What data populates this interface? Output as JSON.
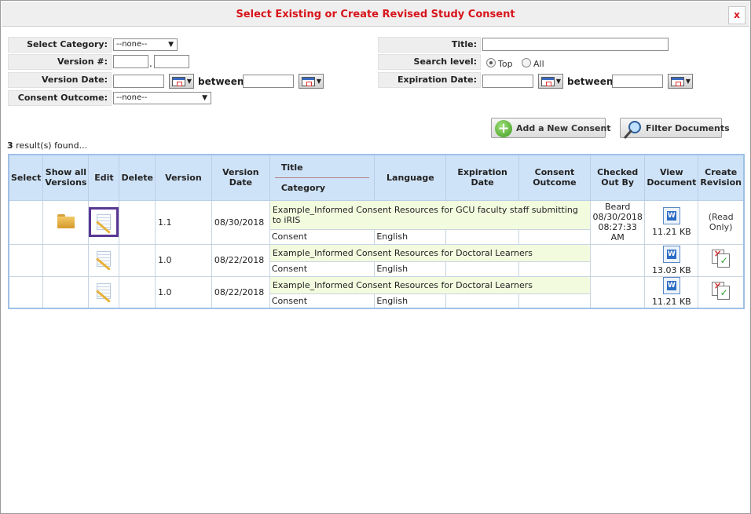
{
  "dialog": {
    "title": "Select Existing or Create Revised Study Consent",
    "close_label": "x"
  },
  "filters": {
    "category_label": "Select Category:",
    "category_value": "--none--",
    "version_label": "Version #:",
    "version_dot": ".",
    "version_date_label": "Version Date:",
    "between_label": "between",
    "outcome_label": "Consent Outcome:",
    "outcome_value": "--none--",
    "title_label": "Title:",
    "search_level_label": "Search level:",
    "search_level_options": [
      "Top",
      "All"
    ],
    "search_level_selected": "Top",
    "expiration_label": "Expiration Date:"
  },
  "actions": {
    "add_label": "Add a New Consent",
    "filter_label": "Filter Documents"
  },
  "results": {
    "count": "3",
    "suffix": " result(s) found..."
  },
  "table": {
    "headers": {
      "select": "Select",
      "show_all": "Show all Versions",
      "edit": "Edit",
      "delete": "Delete",
      "version": "Version",
      "version_date": "Version Date",
      "title": "Title",
      "category": "Category",
      "language": "Language",
      "expiration": "Expiration Date",
      "outcome": "Consent Outcome",
      "checked_out": "Checked Out By",
      "view": "View Document",
      "create_revision": "Create Revision"
    },
    "rows": [
      {
        "version": "1.1",
        "version_date": "08/30/2018",
        "title": "Example_Informed Consent Resources for GCU faculty staff submitting to iRIS",
        "category": "Consent",
        "language": "English",
        "expiration": "",
        "outcome": "",
        "checked_out": "Beard 08/30/2018 08:27:33 AM",
        "doc_size": "11.21 KB",
        "revision": "(Read Only)"
      },
      {
        "version": "1.0",
        "version_date": "08/22/2018",
        "title": "Example_Informed Consent Resources for Doctoral Learners",
        "category": "Consent",
        "language": "English",
        "expiration": "",
        "outcome": "",
        "checked_out": "",
        "doc_size": "13.03 KB",
        "revision": ""
      },
      {
        "version": "1.0",
        "version_date": "08/22/2018",
        "title": "Example_Informed Consent Resources for Doctoral Learners",
        "category": "Consent",
        "language": "English",
        "expiration": "",
        "outcome": "",
        "checked_out": "",
        "doc_size": "11.21 KB",
        "revision": ""
      }
    ]
  },
  "colors": {
    "title_red": "#d8141b",
    "header_blue": "#cfe3f8",
    "title_row_green": "#f3fbdf",
    "highlight_purple": "#5a3794"
  },
  "icons": [
    "close-icon",
    "calendar-icon",
    "plus-icon",
    "magnifier-icon",
    "folder-icon",
    "edit-icon",
    "word-document-icon",
    "create-revision-icon"
  ]
}
